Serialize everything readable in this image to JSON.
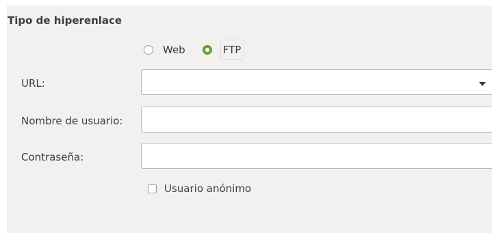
{
  "section": {
    "title": "Tipo de hiperenlace"
  },
  "hyperlink_type": {
    "options": [
      {
        "label": "Web",
        "selected": false
      },
      {
        "label": "FTP",
        "selected": true
      }
    ]
  },
  "fields": {
    "url": {
      "label": "URL:",
      "value": ""
    },
    "username": {
      "label": "Nombre de usuario:",
      "value": ""
    },
    "password": {
      "label": "Contraseña:",
      "value": ""
    }
  },
  "anonymous_user": {
    "label": "Usuario anónimo",
    "checked": false
  },
  "icons": {
    "dropdown": "chevron-down-icon"
  },
  "colors": {
    "panel_background": "#f2f1f0",
    "radio_selected": "#6ea339",
    "field_border": "#b6b6b3",
    "text": "#3c3c3c"
  }
}
